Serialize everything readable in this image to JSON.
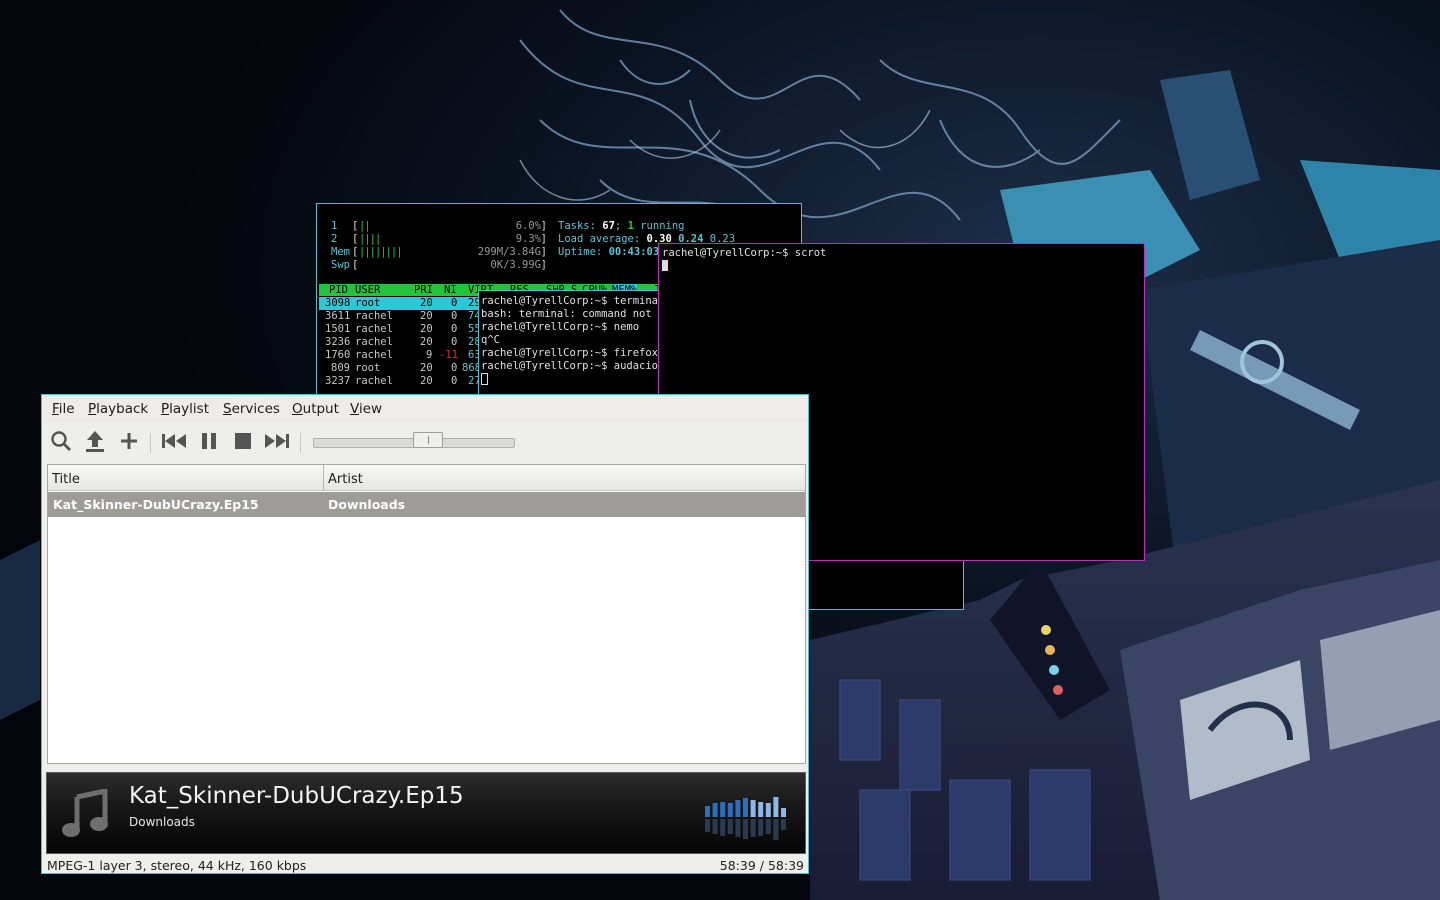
{
  "colors": {
    "terminal_bg": "#000000",
    "window_border_cyan": "#3fc4d0",
    "window_border_magenta": "#c42ac8",
    "htop_header_green": "#22c43a",
    "htop_selected_cyan": "#2fc6d8",
    "htop_label_cyan": "#5bc6d6",
    "player_selected_row": "#9e9c98"
  },
  "htop": {
    "cpu1": {
      "label": "1",
      "bars": "||",
      "value": "6.0%"
    },
    "cpu2": {
      "label": "2",
      "bars": "||||",
      "value": "9.3%"
    },
    "mem": {
      "label": "Mem",
      "bars": "||||||||",
      "value": "299M/3.84G"
    },
    "swp": {
      "label": "Swp",
      "bars": "",
      "value": "0K/3.99G"
    },
    "tasks_label": "Tasks:",
    "tasks_count": "67",
    "running_count": "1",
    "running_label": "running",
    "load_label": "Load average:",
    "load1": "0.30",
    "load5": "0.24",
    "load15": "0.23",
    "uptime_label": "Uptime:",
    "uptime": "00:43:03",
    "columns": [
      "PID",
      "USER",
      "PRI",
      "NI",
      "VIRT",
      "RES",
      "SHR",
      "S",
      "CPU%",
      "MEM%",
      "T"
    ],
    "processes": [
      {
        "pid": "3098",
        "user": "root",
        "pri": "20",
        "ni": "0",
        "virt": "29"
      },
      {
        "pid": "3611",
        "user": "rachel",
        "pri": "20",
        "ni": "0",
        "virt": "74"
      },
      {
        "pid": "1501",
        "user": "rachel",
        "pri": "20",
        "ni": "0",
        "virt": "55"
      },
      {
        "pid": "3236",
        "user": "rachel",
        "pri": "20",
        "ni": "0",
        "virt": "28"
      },
      {
        "pid": "1760",
        "user": "rachel",
        "pri": "9",
        "ni": "-11",
        "virt": "63"
      },
      {
        "pid": "809",
        "user": "root",
        "pri": "20",
        "ni": "0",
        "virt": "868"
      },
      {
        "pid": "3237",
        "user": "rachel",
        "pri": "20",
        "ni": "0",
        "virt": "27"
      }
    ]
  },
  "terminal_back": {
    "lines": [
      "rachel@TyrellCorp:~$ terminal",
      "bash: terminal: command not fo",
      "rachel@TyrellCorp:~$ nemo",
      "q^C",
      "rachel@TyrellCorp:~$ firefox",
      "rachel@TyrellCorp:~$ audacious"
    ]
  },
  "terminal_front": {
    "prompt_line": "rachel@TyrellCorp:~$ scrot"
  },
  "player": {
    "menu": [
      {
        "key": "F",
        "rest": "ile"
      },
      {
        "key": "P",
        "rest": "layback"
      },
      {
        "key": "P",
        "rest": "laylist"
      },
      {
        "key": "S",
        "rest": "ervices"
      },
      {
        "key": "O",
        "rest": "utput"
      },
      {
        "key": "V",
        "rest": "iew"
      }
    ],
    "toolbar_icons": [
      "search-icon",
      "open-icon",
      "add-icon",
      "previous-icon",
      "pause-icon",
      "stop-icon",
      "next-icon"
    ],
    "seek_position": 0.58,
    "columns": {
      "title": "Title",
      "artist": "Artist"
    },
    "rows": [
      {
        "title": "Kat_Skinner-DubUCrazy.Ep15",
        "artist": "Downloads"
      }
    ],
    "now_playing": {
      "title": "Kat_Skinner-DubUCrazy.Ep15",
      "artist": "Downloads"
    },
    "visualizer_levels": [
      0.45,
      0.55,
      0.6,
      0.55,
      0.65,
      0.7,
      0.65,
      0.6,
      0.55,
      0.75,
      0.4
    ],
    "status_format": "MPEG-1 layer 3, stereo, 44 kHz, 160 kbps",
    "status_time": "58:39 / 58:39"
  }
}
